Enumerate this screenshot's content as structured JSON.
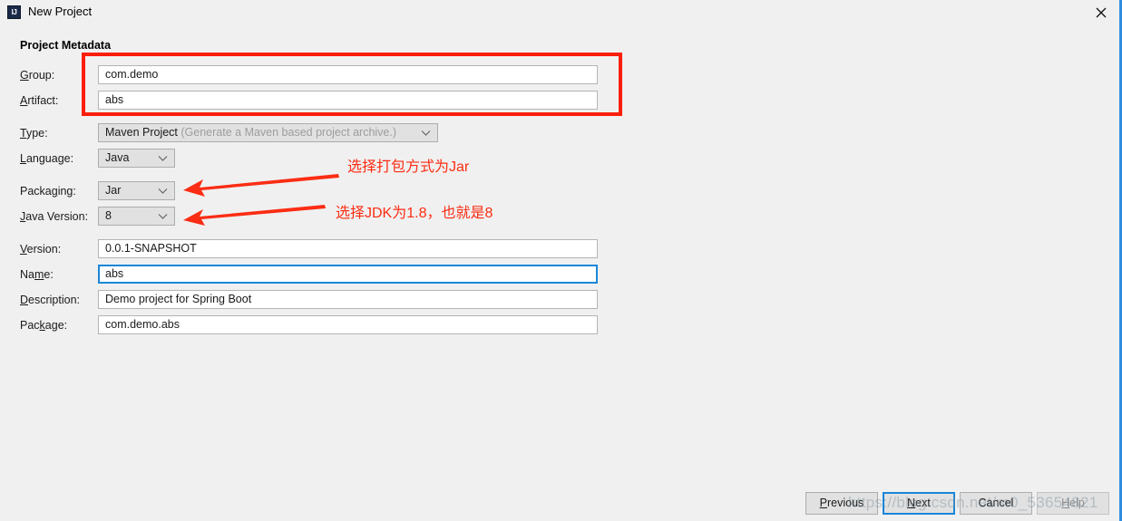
{
  "window": {
    "title": "New Project",
    "icon": "intellij-idea-icon",
    "icon_text": "IJ",
    "close_icon": "close-icon"
  },
  "form": {
    "section_title": "Project Metadata",
    "rows": [
      {
        "label_pre": "",
        "label_key": "G",
        "label_post": "roup:",
        "value": "com.demo"
      },
      {
        "label_pre": "",
        "label_key": "A",
        "label_post": "rtifact:",
        "value": "abs"
      },
      {
        "label_pre": "",
        "label_key": "T",
        "label_post": "ype:",
        "value": "Maven Project",
        "hint": "(Generate a Maven based project archive.)"
      },
      {
        "label_pre": "",
        "label_key": "L",
        "label_post": "anguage:",
        "value": "Java"
      },
      {
        "label_pre": "Packa",
        "label_key": "g",
        "label_post": "ing:",
        "value": "Jar"
      },
      {
        "label_pre": "",
        "label_key": "J",
        "label_post": "ava Version:",
        "value": "8"
      },
      {
        "label_pre": "",
        "label_key": "V",
        "label_post": "ersion:",
        "value": "0.0.1-SNAPSHOT"
      },
      {
        "label_pre": "Na",
        "label_key": "m",
        "label_post": "e:",
        "value": "abs"
      },
      {
        "label_pre": "",
        "label_key": "D",
        "label_post": "escription:",
        "value": "Demo project for Spring Boot"
      },
      {
        "label_pre": "Pac",
        "label_key": "k",
        "label_post": "age:",
        "value": "com.demo.abs"
      }
    ]
  },
  "annotations": {
    "box_color": "#fb1e09",
    "arrow_color": "#fb2d14",
    "note_packaging": "选择打包方式为Jar",
    "note_java_version": "选择JDK为1.8，也就是8"
  },
  "buttons": {
    "previous_pre": "",
    "previous_key": "P",
    "previous_post": "revious",
    "next_pre": "",
    "next_key": "N",
    "next_post": "ext",
    "cancel": "Cancel",
    "help_pre": "",
    "help_key": "H",
    "help_post": "elp"
  },
  "watermark": {
    "text": "https://blog.csdn.net/m0_53654821"
  }
}
